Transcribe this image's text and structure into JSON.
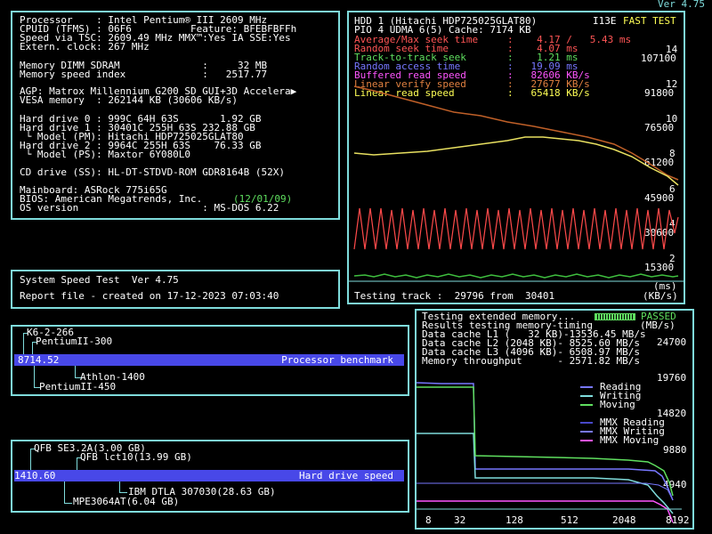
{
  "header": {
    "version": "Ver 4.75"
  },
  "system": {
    "lines": [
      "Processor    : Intel Pentium® III 2609 MHz",
      "CPUID (TFMS) : 06F6          Feature: BFEBFBFFh",
      "Speed via TSC: 2609.49 MHz MMX™:Yes IA SSE:Yes",
      "Extern. clock: 267 MHz",
      "",
      "Memory DIMM SDRAM              :     32 MB",
      "Memory speed index             :   2517.77",
      "",
      "AGP: Matrox Millennium G200 SD GUI+3D Accelera▶",
      "VESA memory  : 262144 KB (30606 KB/s)",
      "",
      "Hard drive 0 : 999C 64H 63S       1.92 GB",
      "Hard drive 1 : 30401C 255H 63S 232.88 GB",
      " └ Model (PM): Hitachi HDP725025GLAT80",
      "Hard drive 2 : 9964C 255H 63S    76.33 GB",
      " └ Model (PS): Maxtor 6Y080L0",
      "",
      "CD drive (SS): HL-DT-STDVD-ROM GDR8164B (52X)",
      "",
      "Mainboard: ASRock 775i65G",
      "BIOS: American Megatrends, Inc.",
      "OS version                     : MS-DOS 6.22"
    ],
    "bios_date": "(12/01/09)"
  },
  "speedtest": {
    "title": "System Speed Test  Ver 4.75",
    "report": "Report file - created on 17-12-2023 07:03:40"
  },
  "hdd": {
    "header_left": "HDD 1 (Hitachi HDP725025GLAT80)",
    "header_right": "I13E",
    "fast_test": "FAST TEST",
    "line2": "PIO 4 UDMA 6(5) Cache: 7174 KB",
    "stats": [
      {
        "label": "Average/Max seek time",
        "value": ":    4.17 /   5.43 ms",
        "color": "#ff5555"
      },
      {
        "label": "Random seek time",
        "value": ":    4.07 ms",
        "color": "#ff5555"
      },
      {
        "label": "Track-to-track seek",
        "value": ":    1.21 ms",
        "color": "#5fdf5f"
      },
      {
        "label": "Random access time",
        "value": ":   19.09 ms",
        "color": "#7777ff"
      },
      {
        "label": "Buffered read speed",
        "value": ":   82606 KB/s",
        "color": "#ff55ff"
      },
      {
        "label": "Linear verify speed",
        "value": ":   27677 KB/s",
        "color": "#e08040"
      },
      {
        "label": "Linear read speed",
        "value": ":   65418 KB/s",
        "color": "#ffff55"
      }
    ],
    "y_left": [
      "14",
      "12",
      "10",
      "8",
      "6",
      "4",
      "2",
      "(ms)"
    ],
    "y_right": [
      "107100",
      "91800",
      "76500",
      "61200",
      "45900",
      "30600",
      "15300",
      "(KB/s)"
    ],
    "footer": "Testing track :  29796 from  30401"
  },
  "memory": {
    "line1": "Testing extended memory...",
    "passed": "PASSED",
    "lines": [
      "Results testing memory-timing        (MB/s)",
      "Data cache L1 (   32 KB)-13536.45 MB/s",
      "Data cache L2 (2048 KB)- 8525.60 MB/s",
      "Data cache L3 (4096 KB)- 6508.97 MB/s",
      "Memory throughput      - 2571.82 MB/s"
    ],
    "y_right": [
      "24700",
      "19760",
      "14820",
      "9880",
      "4940"
    ],
    "x_ticks": [
      "8",
      "32",
      "128",
      "512",
      "2048",
      "8192"
    ],
    "legend": [
      {
        "label": "Reading",
        "color": "#7777ff"
      },
      {
        "label": "Writing",
        "color": "#7fdcdc"
      },
      {
        "label": "Moving",
        "color": "#5fdf5f"
      },
      {
        "label": "MMX Reading",
        "color": "#4848c8"
      },
      {
        "label": "MMX Writing",
        "color": "#7777ff"
      },
      {
        "label": "MMX Moving",
        "color": "#ff55ff"
      }
    ]
  },
  "proc_bench": {
    "value": "8714.52",
    "label": "Processor benchmark",
    "refs": [
      "K6-2-266",
      "PentiumII-300",
      "Athlon-1400",
      "PentiumII-450"
    ]
  },
  "hd_bench": {
    "value": "1410.60",
    "label": "Hard drive speed",
    "refs": [
      "QFB SE3.2A(3.00 GB)",
      "QFB lct10(13.99 GB)",
      "IBM DTLA 307030(28.63 GB)",
      "MPE3064AT(6.04 GB)"
    ]
  }
}
